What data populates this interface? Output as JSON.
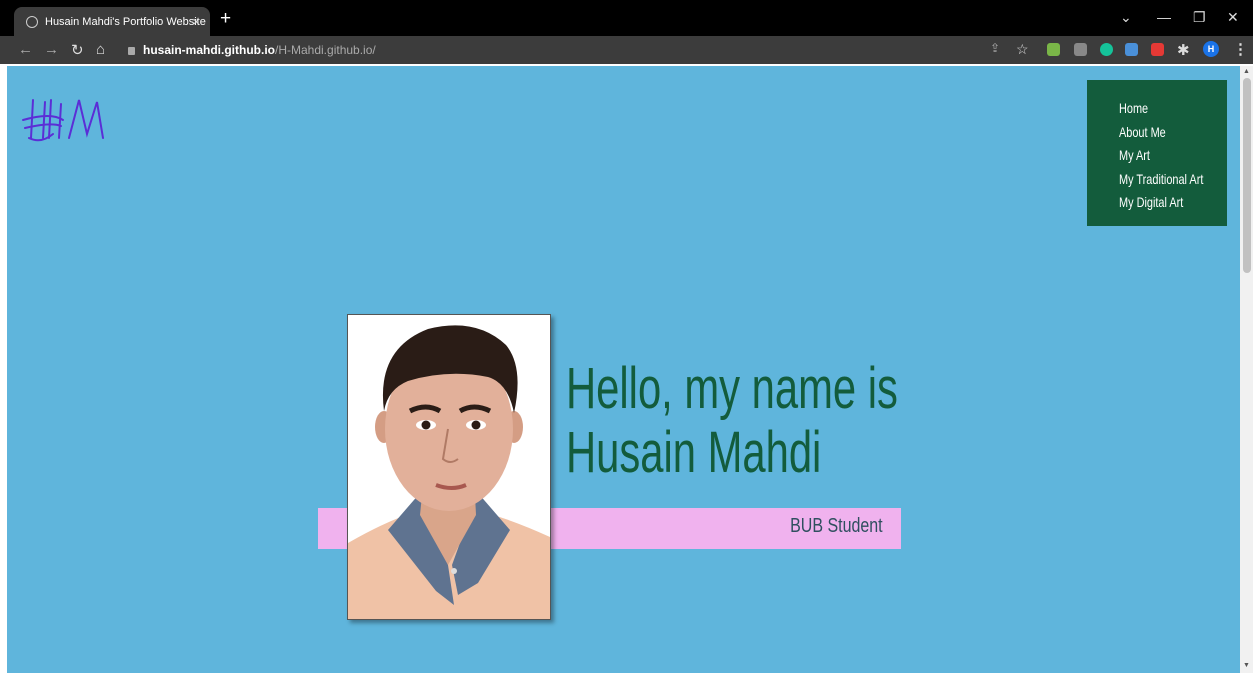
{
  "browser": {
    "tab_title": "Husain Mahdi's Portfolio Website",
    "tab_close": "×",
    "new_tab": "+",
    "url_host": "husain-mahdi.github.io",
    "url_path": "/H-Mahdi.github.io/",
    "profile_initial": "H"
  },
  "site": {
    "logo_text": "HM",
    "nav": [
      {
        "label": "Home"
      },
      {
        "label": "About Me"
      },
      {
        "label": "My Art"
      },
      {
        "label": "My Traditional Art"
      },
      {
        "label": "My Digital Art"
      }
    ],
    "greeting_line1": "Hello, my name is",
    "greeting_name": "Husain Mahdi",
    "subtitle": "BUB Student",
    "colors": {
      "background": "#5fb5dc",
      "nav_bg": "#135c3c",
      "accent_green": "#135c3c",
      "band_pink": "#f0b2ee",
      "logo_purple": "#5b2ed6"
    }
  }
}
